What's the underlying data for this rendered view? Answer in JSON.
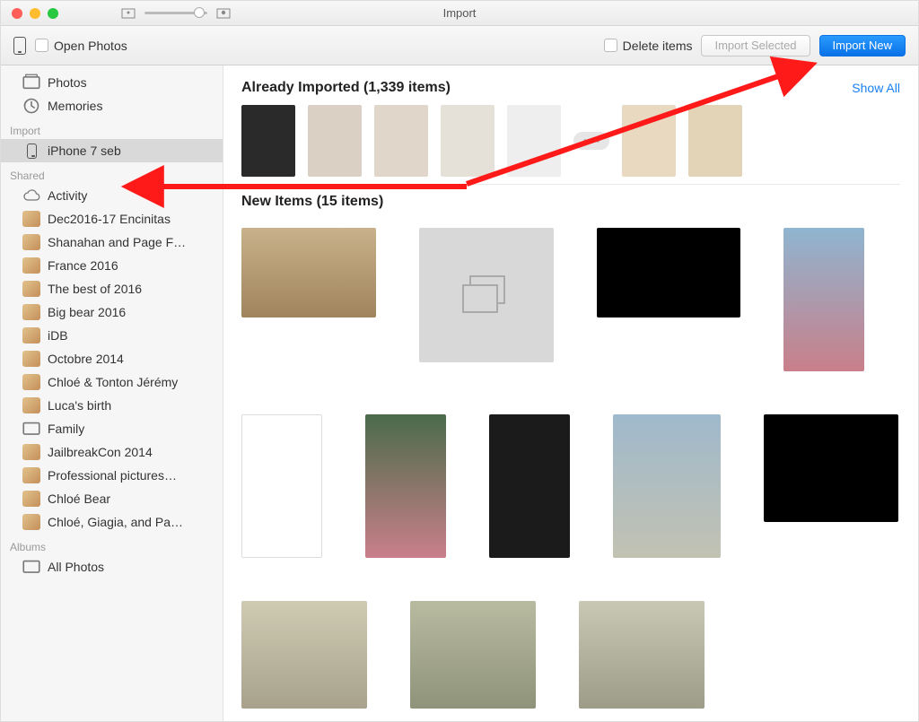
{
  "window": {
    "title": "Import"
  },
  "toolbar": {
    "open_photos_label": "Open Photos",
    "delete_items_label": "Delete items",
    "import_selected_label": "Import Selected",
    "import_new_label": "Import New"
  },
  "sidebar": {
    "groups": [
      {
        "label": null,
        "items": [
          {
            "icon": "photos",
            "label": "Photos"
          },
          {
            "icon": "clock",
            "label": "Memories"
          }
        ]
      },
      {
        "label": "Import",
        "items": [
          {
            "icon": "phone",
            "label": "iPhone 7 seb",
            "selected": true
          }
        ]
      },
      {
        "label": "Shared",
        "items": [
          {
            "icon": "cloud",
            "label": "Activity"
          },
          {
            "icon": "thumb",
            "label": "Dec2016-17 Encinitas"
          },
          {
            "icon": "thumb",
            "label": "Shanahan and Page F…"
          },
          {
            "icon": "thumb",
            "label": "France 2016"
          },
          {
            "icon": "thumb",
            "label": "The best of 2016"
          },
          {
            "icon": "thumb",
            "label": "Big bear 2016"
          },
          {
            "icon": "thumb",
            "label": "iDB"
          },
          {
            "icon": "thumb",
            "label": "Octobre 2014"
          },
          {
            "icon": "thumb",
            "label": "Chloé & Tonton Jérémy"
          },
          {
            "icon": "thumb",
            "label": "Luca's birth"
          },
          {
            "icon": "rect",
            "label": "Family"
          },
          {
            "icon": "thumb",
            "label": "JailbreakCon 2014"
          },
          {
            "icon": "thumb",
            "label": "Professional pictures…"
          },
          {
            "icon": "thumb",
            "label": "Chloé Bear"
          },
          {
            "icon": "thumb",
            "label": "Chloé, Giagia, and Pa…"
          }
        ]
      },
      {
        "label": "Albums",
        "items": [
          {
            "icon": "rect",
            "label": "All Photos"
          }
        ]
      }
    ]
  },
  "main": {
    "already_imported_header": "Already Imported (1,339 items)",
    "show_all_label": "Show All",
    "already_imported_count": 8,
    "new_items_header": "New Items (15 items)",
    "new_items": [
      {
        "style": "background:linear-gradient(#c8b18b,#a0845d);width:150px;height:100px"
      },
      {
        "style": "background:#d8d8d8;width:150px;height:150px",
        "placeholder": true
      },
      {
        "style": "background:#000;width:160px;height:100px"
      },
      {
        "style": "background:linear-gradient(#8fb5d0,#c97f8a);width:90px;height:160px"
      },
      {
        "style": "background:#fff;border:1px solid #ddd;width:90px;height:160px"
      },
      {
        "style": "background:linear-gradient(#4a6b4a,#c97f8a);width:90px;height:160px"
      },
      {
        "style": "background:#1b1b1b;width:90px;height:160px"
      },
      {
        "style": "background:linear-gradient(#9fb9cc,#c2c2b2);width:120px;height:160px"
      },
      {
        "style": "background:#000;width:150px;height:120px"
      },
      {
        "style": "background:linear-gradient(#cfcab2,#a8a28c);width:140px;height:120px"
      },
      {
        "style": "background:linear-gradient(#b8bba0,#8f937a);width:140px;height:120px"
      },
      {
        "style": "background:linear-gradient(#c8c8b4,#9c9c88);width:140px;height:120px"
      }
    ]
  }
}
